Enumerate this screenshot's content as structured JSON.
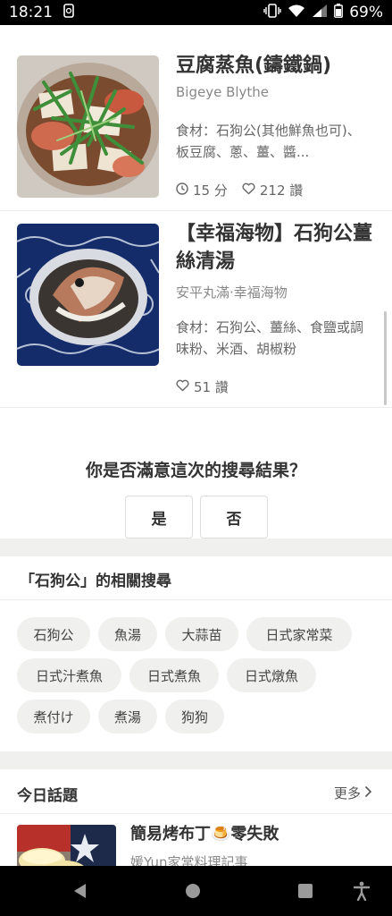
{
  "status_bar": {
    "time": "18:21",
    "battery": "69%",
    "icons": [
      "notification-icon",
      "vibrate-icon",
      "wifi-icon",
      "signal-icon",
      "battery-icon"
    ]
  },
  "recipes": [
    {
      "title": "豆腐蒸魚(鑄鐵鍋)",
      "author": "Bigeye Blythe",
      "ingredients": "食材：石狗公(其他鮮魚也可)、板豆腐、蔥、薑、醬...",
      "time": "15 分",
      "likes": "212 讚"
    },
    {
      "title": "【幸福海物】石狗公薑絲清湯",
      "author": "安平丸滿‧幸福海物",
      "ingredients": "食材：石狗公、薑絲、食鹽或調味粉、米酒、胡椒粉",
      "likes": "51 讚"
    }
  ],
  "survey": {
    "question": "你是否滿意這次的搜尋結果？",
    "yes": "是",
    "no": "否"
  },
  "related": {
    "header": "「石狗公」的相關搜尋",
    "chips": [
      "石狗公",
      "魚湯",
      "大蒜苗",
      "日式家常菜",
      "日式汁煮魚",
      "日式煮魚",
      "日式燉魚",
      "煮付け",
      "煮湯",
      "狗狗"
    ]
  },
  "today": {
    "header": "今日話題",
    "more": "更多",
    "item_title": "簡易烤布丁🍮零失敗",
    "item_author": "媛Yun家常料理記事"
  },
  "colors": {
    "background": "#ffffff",
    "chip_bg": "#f0f0ee",
    "text": "#333333",
    "muted": "#888888"
  }
}
